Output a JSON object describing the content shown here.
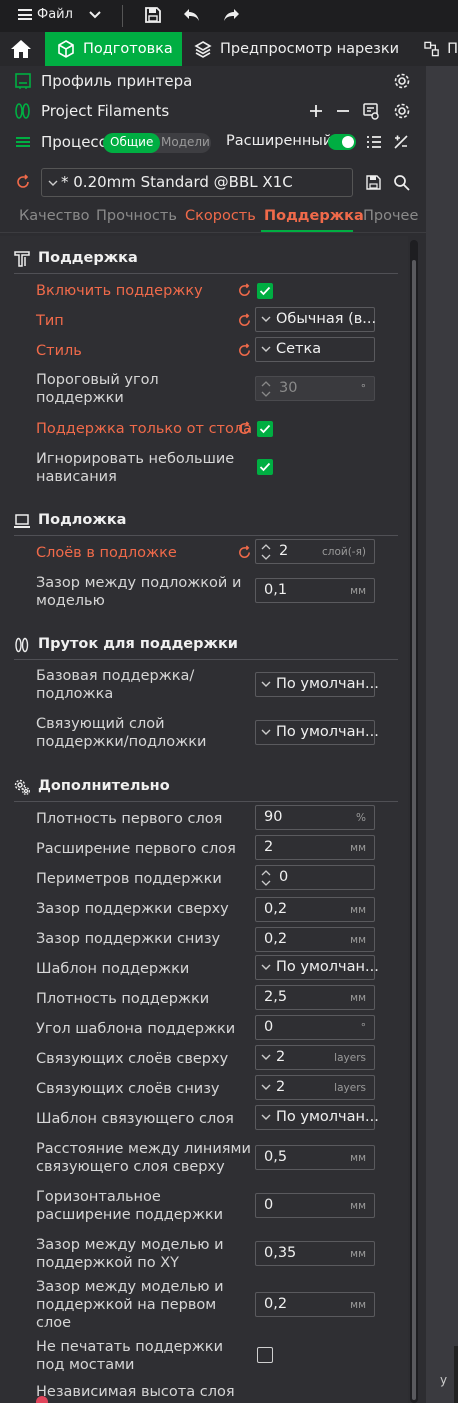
{
  "titlebar": {
    "menu_label": "Файл",
    "icons": [
      "menu-icon",
      "chevron-down-icon",
      "save-icon",
      "undo-icon",
      "redo-icon"
    ]
  },
  "tabs": [
    {
      "label": "Подготовка",
      "icon": "cube-icon",
      "active": true
    },
    {
      "label": "Предпросмотр нарезки",
      "icon": "layers-icon",
      "active": false
    },
    {
      "label": "П",
      "icon": "multi-device-icon",
      "active": false
    }
  ],
  "sidebar": {
    "printer_profile": "Профиль принтера",
    "filaments": "Project Filaments",
    "process": "Процесс",
    "process_modes": {
      "global": "Общие",
      "objects": "Модели"
    },
    "advanced": "Расширенный",
    "preset": "* 0.20mm Standard @BBL X1C"
  },
  "subtabs": [
    {
      "label": "Качество",
      "state": "normal"
    },
    {
      "label": "Прочность",
      "state": "normal"
    },
    {
      "label": "Скорость",
      "state": "modified"
    },
    {
      "label": "Поддержка",
      "state": "active"
    },
    {
      "label": "Прочее",
      "state": "normal"
    }
  ],
  "sections": {
    "support": "Поддержка",
    "raft": "Подложка",
    "filament": "Пруток для поддержки",
    "advanced": "Дополнительно"
  },
  "settings": {
    "enable_support": {
      "label": "Включить поддержку",
      "checked": true
    },
    "type": {
      "label": "Тип",
      "value": "Обычная (в..."
    },
    "style": {
      "label": "Стиль",
      "value": "Сетка"
    },
    "threshold_angle": {
      "label": "Пороговый угол поддержки",
      "value": "30",
      "unit": "°"
    },
    "on_build_plate_only": {
      "label": "Поддержка только от стола",
      "checked": true
    },
    "ignore_small_overhangs": {
      "label": "Игнорировать небольшие нависания",
      "checked": true
    },
    "raft_layers": {
      "label": "Слоёв в подложке",
      "value": "2",
      "unit": "слой(-я)"
    },
    "raft_gap": {
      "label": "Зазор между подложкой и моделью",
      "value": "0,1",
      "unit": "мм"
    },
    "base_filament": {
      "label": "Базовая поддержка/подложка",
      "value": "По умолчан..."
    },
    "interface_filament": {
      "label": "Связующий слой поддержки/подложки",
      "value": "По умолчан..."
    },
    "initial_density": {
      "label": "Плотность первого слоя",
      "value": "90",
      "unit": "%"
    },
    "initial_expansion": {
      "label": "Расширение первого слоя",
      "value": "2",
      "unit": "мм"
    },
    "wall_loops": {
      "label": "Периметров поддержки",
      "value": "0"
    },
    "top_z": {
      "label": "Зазор поддержки сверху",
      "value": "0,2",
      "unit": "мм"
    },
    "bottom_z": {
      "label": "Зазор поддержки снизу",
      "value": "0,2",
      "unit": "мм"
    },
    "base_pattern": {
      "label": "Шаблон поддержки",
      "value": "По умолчан..."
    },
    "density": {
      "label": "Плотность поддержки",
      "value": "2,5",
      "unit": "мм"
    },
    "pattern_angle": {
      "label": "Угол шаблона поддержки",
      "value": "0",
      "unit": "°"
    },
    "top_interface_layers": {
      "label": "Связующих слоёв сверху",
      "value": "2",
      "unit": "layers"
    },
    "bottom_interface_layers": {
      "label": "Связующих слоёв снизу",
      "value": "2",
      "unit": "layers"
    },
    "interface_pattern": {
      "label": "Шаблон связующего слоя",
      "value": "По умолчан..."
    },
    "interface_spacing": {
      "label": "Расстояние между линиями связующего слоя сверху",
      "value": "0,5",
      "unit": "мм"
    },
    "horizontal_expansion": {
      "label": "Горизонтальное расширение поддержки",
      "value": "0",
      "unit": "мм"
    },
    "xy_distance": {
      "label": "Зазор между моделью и поддержкой по XY",
      "value": "0,35",
      "unit": "мм"
    },
    "first_layer_gap": {
      "label": "Зазор между моделью и поддержкой на первом слое",
      "value": "0,2",
      "unit": "мм"
    },
    "no_bridges": {
      "label": "Не печатать поддержки под мостами",
      "checked": false
    },
    "partial_label": "Независимая высота слоя"
  },
  "viewport": {
    "axis_label": "y"
  },
  "colors": {
    "accent": "#00ae42",
    "modified": "#f06a4a",
    "panel": "#2f2f33"
  }
}
